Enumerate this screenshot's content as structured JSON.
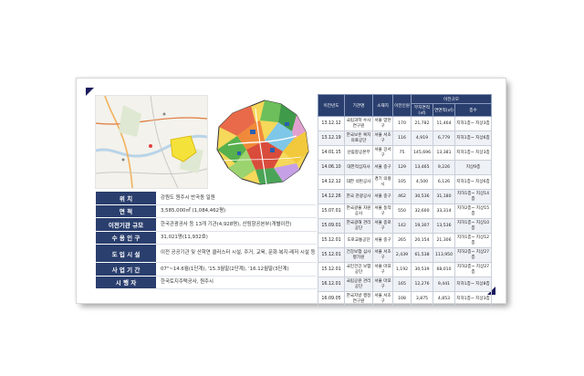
{
  "info_table": [
    {
      "key": "위      치",
      "value": "강원도 원주시 반곡동 일원"
    },
    {
      "key": "면      적",
      "value": "3,585,000㎡ (1,084,462평)"
    },
    {
      "key": "이전기관 규모",
      "value": "한국관광공사 등 13개 기관(4,928명), 산림항공본부(개별이전)"
    },
    {
      "key": "수 용 인 구",
      "value": "31,021명(11,932호)"
    },
    {
      "key": "도 입 시 설",
      "value": "이전 공공기관 및 산학연 클러스터 시설, 주거, 교육, 문화·복지·레저 시설 등"
    },
    {
      "key": "사 업 기 간",
      "value": "07\"~14.6월(1단계), '15.3월말(2단계), '16.12월말(3단계)"
    },
    {
      "key": "시  행  자",
      "value": "한국토지주택공사, 원주시"
    }
  ],
  "relocation_table": {
    "headers": {
      "date": "이전년도",
      "agency": "기관명",
      "location": "소재지",
      "staff": "이전인원",
      "scale": "이전규모",
      "site_area": "부지면적(㎡)",
      "floor_area": "연면적(㎡)",
      "floors": "층수"
    },
    "rows": [
      {
        "date": "13.12.12",
        "agency": "국립과학 수사연구원",
        "location": "서울 양천구",
        "staff": "170",
        "site_area": "21,782",
        "floor_area": "11,464",
        "floors": "지하1층~ 지상3층"
      },
      {
        "date": "13.12.19",
        "agency": "한국보훈 복지의료공단",
        "location": "서울 서초구",
        "staff": "116",
        "site_area": "4,919",
        "floor_area": "6,779",
        "floors": "지하1층~ 지상6층"
      },
      {
        "date": "14.01.15",
        "agency": "산림항공본부",
        "location": "서울 강서구",
        "staff": "75",
        "site_area": "145,696",
        "floor_area": "13,381",
        "floors": "지하1층~ 지상3층"
      },
      {
        "date": "14.06.10",
        "agency": "대한적십자사",
        "location": "서울 중구",
        "staff": "129",
        "site_area": "13,465",
        "floor_area": "9,226",
        "floors": "지상9층"
      },
      {
        "date": "14.12.12",
        "agency": "대한 석탄공사",
        "location": "경기 의왕시",
        "staff": "105",
        "site_area": "4,500",
        "floor_area": "6,126",
        "floors": "지하1층~ 지상6층"
      },
      {
        "date": "14.12.26",
        "agency": "한국 관광공사",
        "location": "서울 중구",
        "staff": "462",
        "site_area": "30,536",
        "floor_area": "31,180",
        "floors": "지하1층~ 지상14층"
      },
      {
        "date": "15.07.01",
        "agency": "한국광물 자원공사",
        "location": "서울 동작구",
        "staff": "550",
        "site_area": "32,600",
        "floor_area": "33,314",
        "floors": "지하2층~ 지상15층"
      },
      {
        "date": "15.09.01",
        "agency": "한국광해 관리공단",
        "location": "서울 종로구",
        "staff": "142",
        "site_area": "19,307",
        "floor_area": "13,536",
        "floors": "지하1층~ 지상10층"
      },
      {
        "date": "15.12.01",
        "agency": "도로교통공단",
        "location": "서울 중구",
        "staff": "265",
        "site_area": "20,154",
        "floor_area": "21,306",
        "floors": "지하1층~ 지상12층"
      },
      {
        "date": "15.12.01",
        "agency": "건강보험 심사평가원",
        "location": "서울 서초구",
        "staff": "2,439",
        "site_area": "61,538",
        "floor_area": "113,950",
        "floors": "지하2층~ 지상27층"
      },
      {
        "date": "15.12.01",
        "agency": "국민건강 보험공단",
        "location": "서울 마포구",
        "staff": "1,192",
        "site_area": "30,539",
        "floor_area": "68,010",
        "floors": "지하2층~ 지상27층"
      },
      {
        "date": "16.12.01",
        "agency": "국립공원 관리공단",
        "location": "서울 마포구",
        "staff": "165",
        "site_area": "12,276",
        "floor_area": "9,441",
        "floors": "지하1층~ 지상8층"
      },
      {
        "date": "16.09.05",
        "agency": "한국지방 행정연구원",
        "location": "서울 서초구",
        "staff": "108",
        "site_area": "3,875",
        "floor_area": "4,853",
        "floors": "지하1층~ 지상3층"
      }
    ]
  }
}
